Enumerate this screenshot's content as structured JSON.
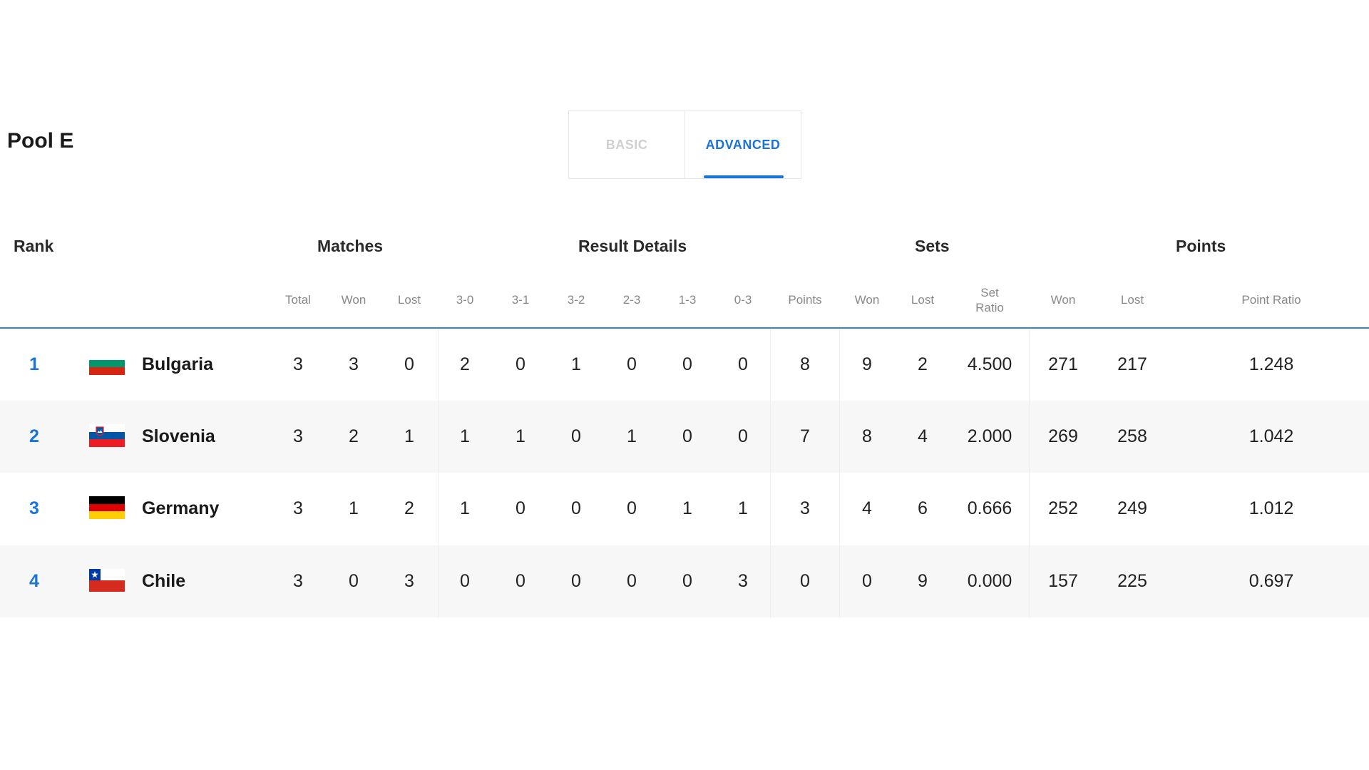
{
  "pool": {
    "title": "Pool E"
  },
  "tabs": {
    "basic": "BASIC",
    "advanced": "ADVANCED",
    "active": "advanced"
  },
  "groups": {
    "rank": "Rank",
    "matches": "Matches",
    "result_details": "Result Details",
    "sets": "Sets",
    "points": "Points"
  },
  "columns": {
    "matches_total": "Total",
    "matches_won": "Won",
    "matches_lost": "Lost",
    "r30": "3-0",
    "r31": "3-1",
    "r32": "3-2",
    "r23": "2-3",
    "r13": "1-3",
    "r03": "0-3",
    "points": "Points",
    "sets_won": "Won",
    "sets_lost": "Lost",
    "set_ratio_line1": "Set",
    "set_ratio_line2": "Ratio",
    "points_won": "Won",
    "points_lost": "Lost",
    "point_ratio": "Point Ratio"
  },
  "rows": [
    {
      "rank": "1",
      "team": "Bulgaria",
      "flag": "bulgaria-flag",
      "flag_colors": [
        "#ffffff",
        "#00966e",
        "#d62612"
      ],
      "total": "3",
      "won": "3",
      "lost": "0",
      "r30": "2",
      "r31": "0",
      "r32": "1",
      "r23": "0",
      "r13": "0",
      "r03": "0",
      "points": "8",
      "sets_won": "9",
      "sets_lost": "2",
      "set_ratio": "4.500",
      "points_won": "271",
      "points_lost": "217",
      "point_ratio": "1.248"
    },
    {
      "rank": "2",
      "team": "Slovenia",
      "flag": "slovenia-flag",
      "flag_colors": [
        "#ffffff",
        "#0055a4",
        "#ed1c24"
      ],
      "total": "3",
      "won": "2",
      "lost": "1",
      "r30": "1",
      "r31": "1",
      "r32": "0",
      "r23": "1",
      "r13": "0",
      "r03": "0",
      "points": "7",
      "sets_won": "8",
      "sets_lost": "4",
      "set_ratio": "2.000",
      "points_won": "269",
      "points_lost": "258",
      "point_ratio": "1.042"
    },
    {
      "rank": "3",
      "team": "Germany",
      "flag": "germany-flag",
      "flag_colors": [
        "#000000",
        "#dd0000",
        "#ffce00"
      ],
      "total": "3",
      "won": "1",
      "lost": "2",
      "r30": "1",
      "r31": "0",
      "r32": "0",
      "r23": "0",
      "r13": "1",
      "r03": "1",
      "points": "3",
      "sets_won": "4",
      "sets_lost": "6",
      "set_ratio": "0.666",
      "points_won": "252",
      "points_lost": "249",
      "point_ratio": "1.012"
    },
    {
      "rank": "4",
      "team": "Chile",
      "flag": "chile-flag",
      "flag_colors": [
        "#ffffff",
        "#d52b1e",
        "#0039a6"
      ],
      "total": "3",
      "won": "0",
      "lost": "3",
      "r30": "0",
      "r31": "0",
      "r32": "0",
      "r23": "0",
      "r13": "0",
      "r03": "3",
      "points": "0",
      "sets_won": "0",
      "sets_lost": "9",
      "set_ratio": "0.000",
      "points_won": "157",
      "points_lost": "225",
      "point_ratio": "0.697"
    }
  ],
  "colors": {
    "accent": "#1a73d9",
    "header_line": "#3d84c6",
    "alt_row": "#f7f7f7"
  }
}
